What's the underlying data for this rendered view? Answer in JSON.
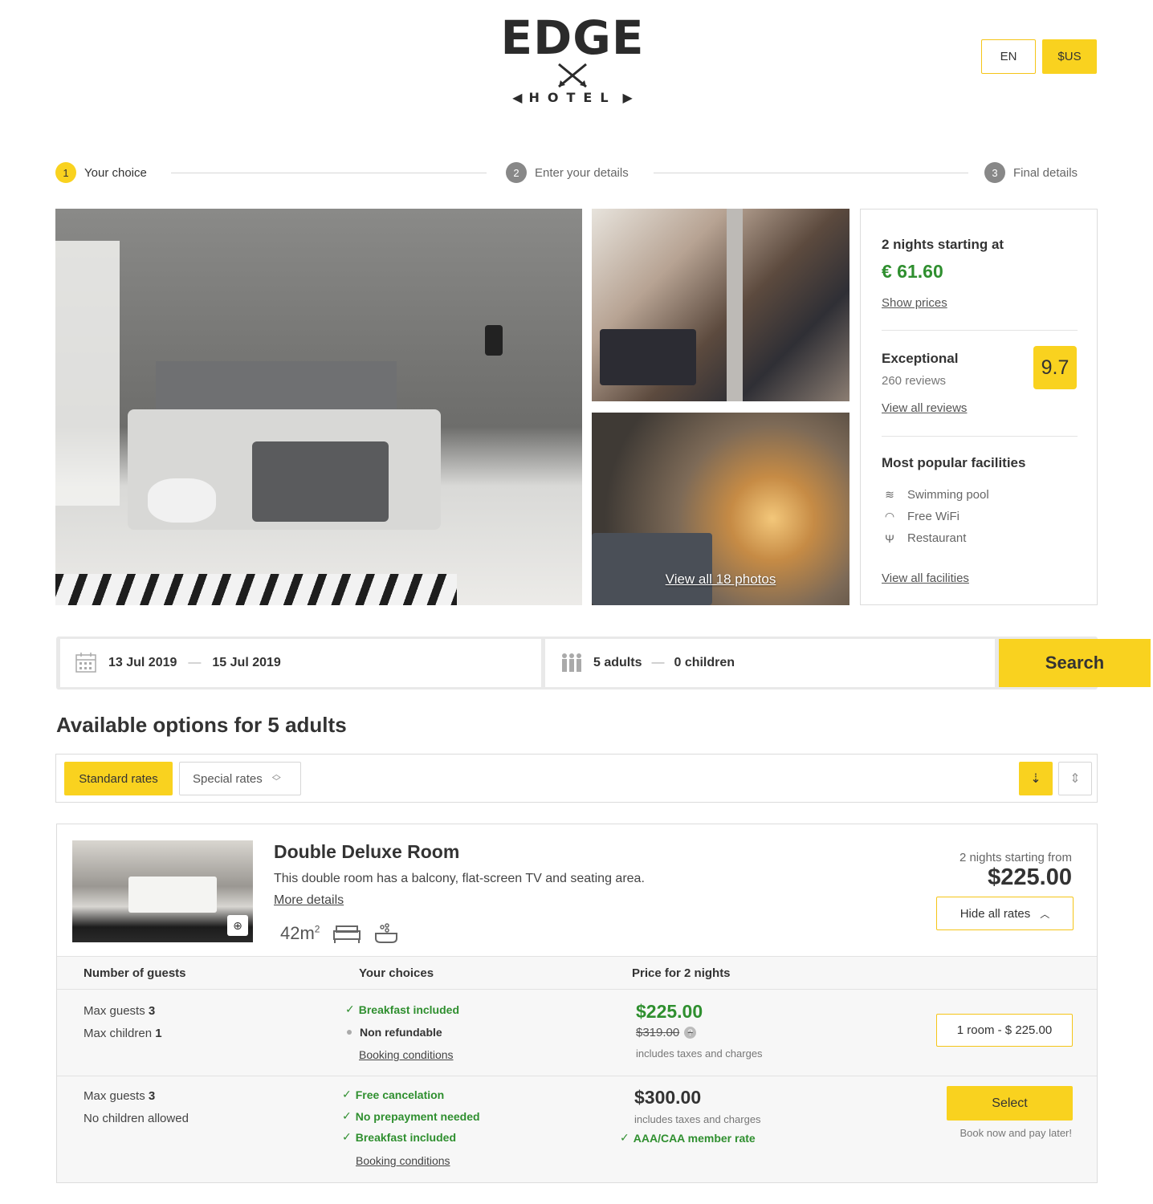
{
  "header": {
    "logo_word": "EDGE",
    "logo_sub": "HOTEL",
    "language": "EN",
    "currency": "$US"
  },
  "steps": [
    {
      "num": "1",
      "label": "Your choice"
    },
    {
      "num": "2",
      "label": "Enter your details"
    },
    {
      "num": "3",
      "label": "Final details"
    }
  ],
  "gallery": {
    "view_all_label": "View all 18 photos"
  },
  "info": {
    "nights_label": "2 nights starting at",
    "price": "€ 61.60",
    "show_prices": "Show prices",
    "rating_label": "Exceptional",
    "reviews": "260 reviews",
    "score": "9.7",
    "view_reviews": "View all reviews",
    "facilities_title": "Most popular facilities",
    "facilities": [
      "Swimming pool",
      "Free WiFi",
      "Restaurant"
    ],
    "view_facilities": "View all facilities"
  },
  "search": {
    "check_in": "13 Jul 2019",
    "check_out": "15 Jul 2019",
    "adults": "5 adults",
    "children": "0 children",
    "button": "Search"
  },
  "options_title": "Available options for 5 adults",
  "filters": {
    "standard": "Standard rates",
    "special": "Special rates"
  },
  "room": {
    "name": "Double Deluxe Room",
    "description": "This double room has a balcony, flat-screen TV and seating area.",
    "more_details": "More details",
    "size": "42m",
    "size_sup": "2",
    "from_label": "2 nights starting from",
    "from_price": "$225.00",
    "hide_rates": "Hide all rates",
    "columns": [
      "Number of guests",
      "Your choices",
      "Price for 2 nights"
    ],
    "rates": [
      {
        "max_guests_label": "Max guests",
        "max_guests": "3",
        "children_label": "Max children",
        "children": "1",
        "choices_green": [
          "Breakfast included"
        ],
        "choices_neutral": [
          "Non refundable"
        ],
        "booking_conditions": "Booking conditions",
        "price": "$225.00",
        "old_price": "$319.00",
        "price_note": "includes taxes and charges",
        "button": "1 room - $ 225.00"
      },
      {
        "max_guests_label": "Max guests",
        "max_guests": "3",
        "children_text": "No children allowed",
        "choices_green": [
          "Free cancelation",
          "No prepayment needed",
          "Breakfast included"
        ],
        "booking_conditions": "Booking conditions",
        "price": "$300.00",
        "price_note": "includes taxes and charges",
        "member_rate": "AAA/CAA member rate",
        "button": "Select",
        "button_note": "Book now and pay later!"
      }
    ]
  },
  "colors": {
    "accent": "#f9d21f",
    "price_green": "#2f8f2f",
    "text": "#333333"
  }
}
